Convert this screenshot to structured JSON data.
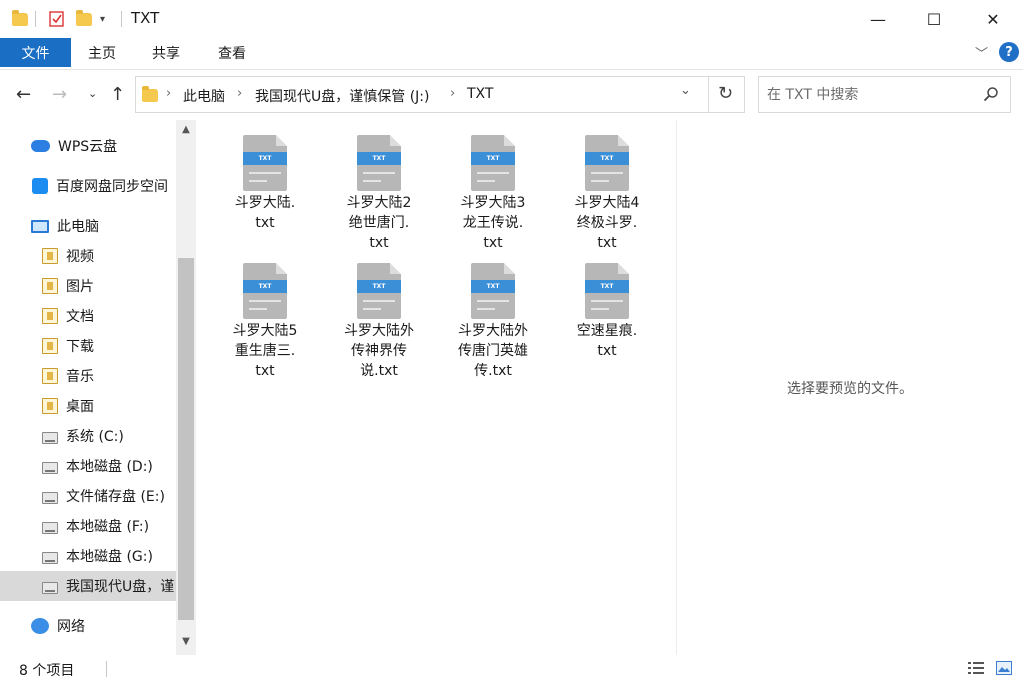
{
  "window": {
    "title": "TXT",
    "controls": {
      "minimize": "—",
      "maximize": "☐",
      "close": "✕"
    }
  },
  "ribbon": {
    "file_tab": "文件",
    "tabs": [
      "主页",
      "共享",
      "查看"
    ],
    "help": "?"
  },
  "nav": {
    "breadcrumb": [
      "此电脑",
      "我国现代U盘，谨慎保管 (J:)",
      "TXT"
    ],
    "separator": "›"
  },
  "search": {
    "placeholder": "在 TXT 中搜索"
  },
  "sidebar": {
    "items": [
      {
        "label": "WPS云盘",
        "icon": "cloud-icon"
      },
      {
        "label": "百度网盘同步空间",
        "icon": "baidu-netdisk-icon"
      },
      {
        "label": "此电脑",
        "icon": "computer-icon"
      },
      {
        "label": "视频",
        "icon": "videos-library-icon"
      },
      {
        "label": "图片",
        "icon": "pictures-library-icon"
      },
      {
        "label": "文档",
        "icon": "documents-library-icon"
      },
      {
        "label": "下载",
        "icon": "downloads-library-icon"
      },
      {
        "label": "音乐",
        "icon": "music-library-icon"
      },
      {
        "label": "桌面",
        "icon": "desktop-library-icon"
      },
      {
        "label": "系统 (C:)",
        "icon": "system-drive-icon"
      },
      {
        "label": "本地磁盘 (D:)",
        "icon": "drive-icon"
      },
      {
        "label": "文件储存盘 (E:)",
        "icon": "drive-icon"
      },
      {
        "label": "本地磁盘 (F:)",
        "icon": "drive-icon"
      },
      {
        "label": "本地磁盘 (G:)",
        "icon": "drive-icon"
      },
      {
        "label": "我国现代U盘，谨",
        "icon": "usb-drive-icon",
        "selected": true
      },
      {
        "label": "网络",
        "icon": "network-icon"
      }
    ]
  },
  "files": [
    {
      "name_lines": [
        "斗罗大陆.",
        "txt"
      ],
      "badge": "TXT"
    },
    {
      "name_lines": [
        "斗罗大陆2",
        "绝世唐门.",
        "txt"
      ],
      "badge": "TXT"
    },
    {
      "name_lines": [
        "斗罗大陆3",
        "龙王传说.",
        "txt"
      ],
      "badge": "TXT"
    },
    {
      "name_lines": [
        "斗罗大陆4",
        "终极斗罗.",
        "txt"
      ],
      "badge": "TXT"
    },
    {
      "name_lines": [
        "斗罗大陆5",
        "重生唐三.",
        "txt"
      ],
      "badge": "TXT"
    },
    {
      "name_lines": [
        "斗罗大陆外",
        "传神界传",
        "说.txt"
      ],
      "badge": "TXT"
    },
    {
      "name_lines": [
        "斗罗大陆外",
        "传唐门英雄",
        "传.txt"
      ],
      "badge": "TXT"
    },
    {
      "name_lines": [
        "空速星痕.",
        "txt"
      ],
      "badge": "TXT"
    }
  ],
  "preview": {
    "message": "选择要预览的文件。"
  },
  "status": {
    "item_count": "8 个项目"
  },
  "colors": {
    "accent": "#1a6fc4",
    "selection": "#d9d9d9",
    "txt_band": "#3b8fd6"
  }
}
